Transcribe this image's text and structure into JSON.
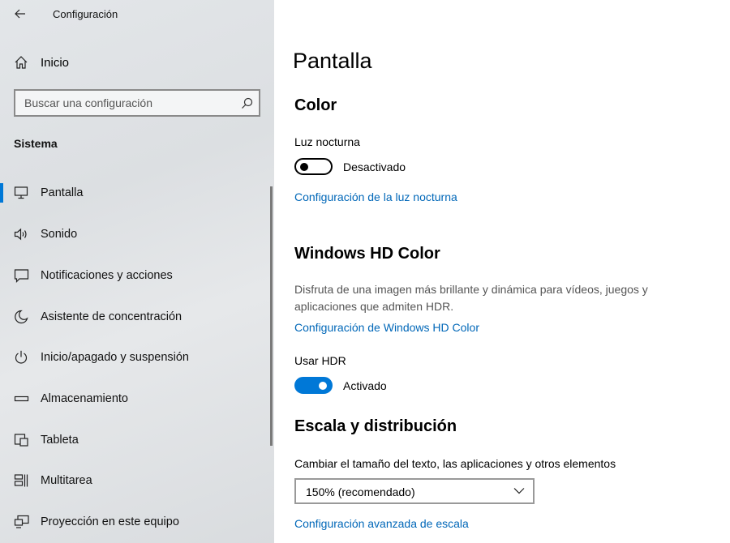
{
  "app": {
    "title": "Configuración"
  },
  "sidebar": {
    "home_label": "Inicio",
    "search_placeholder": "Buscar una configuración",
    "section_label": "Sistema",
    "items": [
      {
        "label": "Pantalla",
        "icon": "monitor-icon",
        "active": true
      },
      {
        "label": "Sonido",
        "icon": "speaker-icon"
      },
      {
        "label": "Notificaciones y acciones",
        "icon": "notification-icon"
      },
      {
        "label": "Asistente de concentración",
        "icon": "moon-icon"
      },
      {
        "label": "Inicio/apagado y suspensión",
        "icon": "power-icon"
      },
      {
        "label": "Almacenamiento",
        "icon": "storage-icon"
      },
      {
        "label": "Tableta",
        "icon": "tablet-icon"
      },
      {
        "label": "Multitarea",
        "icon": "multitask-icon"
      },
      {
        "label": "Proyección en este equipo",
        "icon": "projection-icon"
      }
    ]
  },
  "main": {
    "title": "Pantalla",
    "color": {
      "heading": "Color",
      "night_light_label": "Luz nocturna",
      "night_light_state": "Desactivado",
      "night_light_link": "Configuración de la luz nocturna"
    },
    "hd_color": {
      "heading": "Windows HD Color",
      "description": "Disfruta de una imagen más brillante y dinámica para vídeos, juegos y aplicaciones que admiten HDR.",
      "link": "Configuración de Windows HD Color",
      "hdr_label": "Usar HDR",
      "hdr_state": "Activado"
    },
    "scale": {
      "heading": "Escala y distribución",
      "change_size_label": "Cambiar el tamaño del texto, las aplicaciones y otros elementos",
      "selected": "150% (recomendado)",
      "advanced_link": "Configuración avanzada de escala"
    }
  },
  "colors": {
    "accent": "#0078d7",
    "link": "#0067b8"
  }
}
